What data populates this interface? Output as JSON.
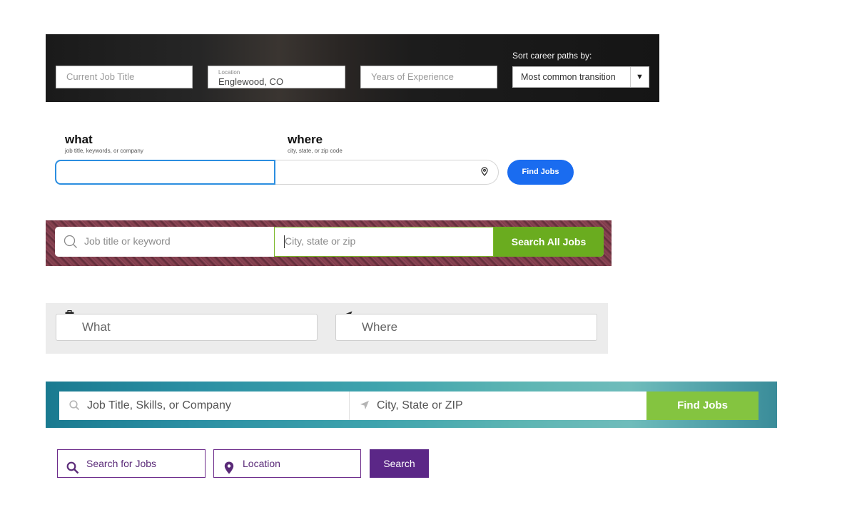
{
  "bar1": {
    "job_title_placeholder": "Current Job Title",
    "location_label": "Location",
    "location_value": "Englewood, CO",
    "experience_placeholder": "Years of Experience",
    "sort_label": "Sort career paths by:",
    "sort_selected": "Most common transition"
  },
  "bar2": {
    "what_heading": "what",
    "what_sub": "job title, keywords, or company",
    "where_heading": "where",
    "where_sub": "city, state, or zip code",
    "button": "Find Jobs"
  },
  "bar3": {
    "keyword_placeholder": "Job title or keyword",
    "location_placeholder": "City, state or zip",
    "button": "Search All Jobs"
  },
  "bar4": {
    "what_placeholder": "What",
    "where_placeholder": "Where"
  },
  "bar5": {
    "keyword_placeholder": "Job Title, Skills, or Company",
    "location_placeholder": "City, State or ZIP",
    "button": "Find Jobs"
  },
  "bar6": {
    "search_placeholder": "Search for Jobs",
    "location_placeholder": "Location",
    "button": "Search"
  }
}
